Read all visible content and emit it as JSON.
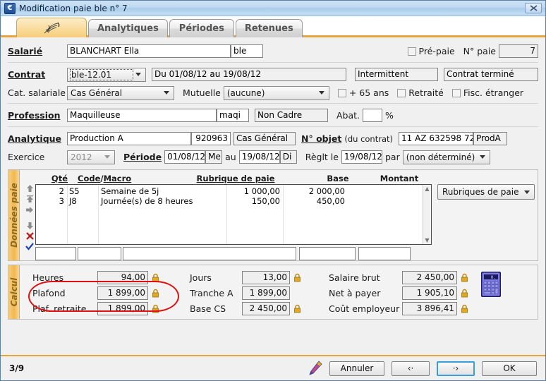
{
  "window": {
    "title": "Modification paie ble n° 7",
    "icon": "euro-icon",
    "close_label": "✖"
  },
  "tabs": [
    {
      "label": "",
      "icon": "feather-icon",
      "active": true
    },
    {
      "label": "Analytiques",
      "active": false
    },
    {
      "label": "Périodes",
      "active": false
    },
    {
      "label": "Retenues",
      "active": false
    }
  ],
  "form": {
    "salarie_label": "Salarié",
    "salarie_value": "BLANCHART Ella",
    "salarie_code": "ble",
    "prepaie_label": "Pré-paie",
    "nopaie_label": "N° paie",
    "nopaie_value": "7",
    "contrat_label": "Contrat",
    "contrat_value": "ble-12.01",
    "contrat_periode": "Du 01/08/12 au 19/08/12",
    "contrat_type": "Intermittent",
    "contrat_statut": "Contrat terminé",
    "cat_label": "Cat. salariale",
    "cat_value": "Cas Général",
    "mutuelle_label": "Mutuelle",
    "mutuelle_value": "(aucune)",
    "plus65_label": "+ 65 ans",
    "retraite_label": "Retraité",
    "fisc_label": "Fisc. étranger",
    "profession_label": "Profession",
    "profession_value": "Maquilleuse",
    "profession_code": "maqi",
    "cadre_value": "Non Cadre",
    "abat_label": "Abat.",
    "abat_value": "",
    "percent_label": "%",
    "analytique_label": "Analytique",
    "analytique_value": "Production A",
    "analytique_code": "920963",
    "analytique_cat": "Cas Général",
    "objet_label": "N° objet",
    "objet_sub": "(du contrat)",
    "objet_value": "11 AZ 632598 72",
    "objet_code": "ProdA",
    "exercice_label": "Exercice",
    "exercice_value": "2012",
    "periode_label": "Période",
    "periode_debut": "01/08/12",
    "periode_debut_jour": "Me",
    "au_label": "au",
    "periode_fin": "19/08/12",
    "periode_fin_jour": "Di",
    "reglt_label": "Règlt le",
    "reglt_value": "19/08/12",
    "par_label": "par",
    "par_value": "(non déterminé)"
  },
  "donnees_paie": {
    "rail_label": "Données paie",
    "columns": [
      "Qté",
      "Code / Macro",
      "Rubrique de paie",
      "Base",
      "Montant"
    ],
    "col_qte": "Qté",
    "col_code": "Code",
    "col_slash": "/",
    "col_macro": "Macro",
    "col_rubrique": "Rubrique de paie",
    "col_base": "Base",
    "col_montant": "Montant",
    "rows": [
      {
        "qte": "2",
        "code": "S5",
        "rubrique": "Semaine de 5j",
        "base": "1 000,00",
        "montant": "2 000,00"
      },
      {
        "qte": "3",
        "code": "J8",
        "rubrique": "Journée(s) de 8 heures",
        "base": "150,00",
        "montant": "450,00"
      }
    ],
    "new_row": {
      "qte": "",
      "code": "",
      "rubrique": "",
      "base": "",
      "montant": ""
    },
    "tools": [
      "move-up-icon",
      "move-top-icon",
      "insert-icon",
      "move-down-icon",
      "delete-icon",
      "validate-icon"
    ],
    "rubriques_button": "Rubriques de paie"
  },
  "calcul": {
    "rail_label": "Calcul",
    "fields": [
      {
        "label": "Heures",
        "value": "94,00",
        "locked": true
      },
      {
        "label": "Plafond",
        "value": "1 899,00",
        "locked": true
      },
      {
        "label": "Plaf. retraite",
        "value": "1 899,00",
        "locked": true
      },
      {
        "label": "Jours",
        "value": "13,00",
        "locked": true
      },
      {
        "label": "Tranche A",
        "value": "1 899,00",
        "locked": false
      },
      {
        "label": "Base CS",
        "value": "2 450,00",
        "locked": true
      },
      {
        "label": "Salaire brut",
        "value": "2 450,00",
        "locked": true
      },
      {
        "label": "Net à payer",
        "value": "1 905,10",
        "locked": true
      },
      {
        "label": "Coût employeur",
        "value": "3 896,41",
        "locked": true
      }
    ],
    "calculator_icon": "calculator-icon",
    "highlight_color": "#e01010"
  },
  "status": {
    "page": "3/9",
    "pencil_icon": "pencil-icon",
    "cancel": "Annuler",
    "prev": "‹·",
    "next": "·›",
    "ok": "OK"
  }
}
